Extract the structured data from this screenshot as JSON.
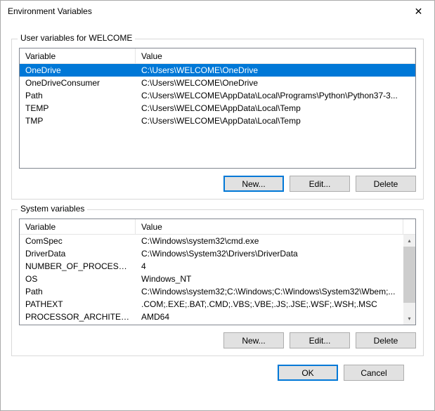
{
  "title": "Environment Variables",
  "userGroup": {
    "label": "User variables for WELCOME",
    "headers": {
      "variable": "Variable",
      "value": "Value"
    },
    "rows": [
      {
        "var": "OneDrive",
        "val": "C:\\Users\\WELCOME\\OneDrive",
        "selected": true
      },
      {
        "var": "OneDriveConsumer",
        "val": "C:\\Users\\WELCOME\\OneDrive"
      },
      {
        "var": "Path",
        "val": "C:\\Users\\WELCOME\\AppData\\Local\\Programs\\Python\\Python37-3..."
      },
      {
        "var": "TEMP",
        "val": "C:\\Users\\WELCOME\\AppData\\Local\\Temp"
      },
      {
        "var": "TMP",
        "val": "C:\\Users\\WELCOME\\AppData\\Local\\Temp"
      }
    ],
    "buttons": {
      "new": "New...",
      "edit": "Edit...",
      "delete": "Delete"
    }
  },
  "sysGroup": {
    "label": "System variables",
    "headers": {
      "variable": "Variable",
      "value": "Value"
    },
    "rows": [
      {
        "var": "ComSpec",
        "val": "C:\\Windows\\system32\\cmd.exe"
      },
      {
        "var": "DriverData",
        "val": "C:\\Windows\\System32\\Drivers\\DriverData"
      },
      {
        "var": "NUMBER_OF_PROCESSORS",
        "val": "4"
      },
      {
        "var": "OS",
        "val": "Windows_NT"
      },
      {
        "var": "Path",
        "val": "C:\\Windows\\system32;C:\\Windows;C:\\Windows\\System32\\Wbem;..."
      },
      {
        "var": "PATHEXT",
        "val": ".COM;.EXE;.BAT;.CMD;.VBS;.VBE;.JS;.JSE;.WSF;.WSH;.MSC"
      },
      {
        "var": "PROCESSOR_ARCHITECTURE",
        "val": "AMD64"
      }
    ],
    "buttons": {
      "new": "New...",
      "edit": "Edit...",
      "delete": "Delete"
    }
  },
  "footer": {
    "ok": "OK",
    "cancel": "Cancel"
  }
}
